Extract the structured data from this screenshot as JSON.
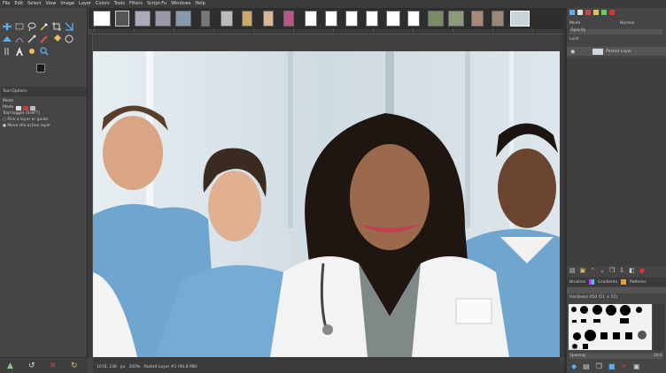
{
  "menu": [
    "File",
    "Edit",
    "Select",
    "View",
    "Image",
    "Layer",
    "Colors",
    "Tools",
    "Filters",
    "Script-Fu",
    "Windows",
    "Help"
  ],
  "tool_options": {
    "tab_label": "Tool Options",
    "mode_label": "Mode",
    "mode2_label": "Mode",
    "tool_toggle": "Tool toggle (SHIFT)",
    "opt_pick": "Pick a layer or guide",
    "opt_move": "Move the active layer"
  },
  "status": {
    "coords": "1078, 236",
    "unit": "px",
    "zoom": "100%",
    "info": "Pasted Layer #1 (90.8 MB)"
  },
  "layers": {
    "mode_label": "Mode",
    "mode_value": "Normal",
    "opacity_label": "Opacity",
    "lock_label": "Lock:",
    "layer_name": "Pasted Layer"
  },
  "brushes": {
    "tabs": [
      "Brushes",
      "Gradients",
      "Patterns"
    ],
    "filter_label": "Hardness 050 (51 × 51)",
    "preset_label": "Basic,",
    "spacing_label": "Spacing",
    "spacing_value": "10.0"
  },
  "colors": {
    "accent": "#1e90ff",
    "fg": "#1a1a1a",
    "bg": "#e8e8e8"
  }
}
